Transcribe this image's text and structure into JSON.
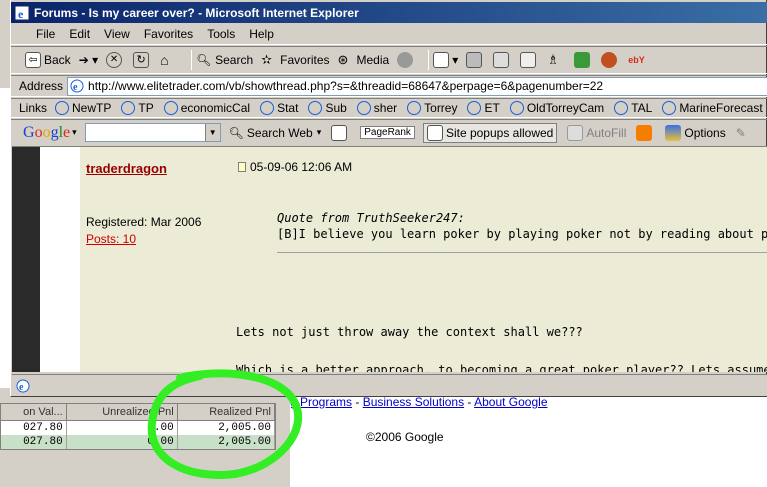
{
  "window": {
    "title": "Forums - Is my career over? - Microsoft Internet Explorer"
  },
  "menu": [
    "File",
    "Edit",
    "View",
    "Favorites",
    "Tools",
    "Help"
  ],
  "toolbar": {
    "back_label": "Back",
    "search_label": "Search",
    "favorites_label": "Favorites",
    "media_label": "Media"
  },
  "address": {
    "label": "Address",
    "url": "http://www.elitetrader.com/vb/showthread.php?s=&threadid=68647&perpage=6&pagenumber=22"
  },
  "links": {
    "label": "Links",
    "items": [
      "NewTP",
      "TP",
      "economicCal",
      "Stat",
      "Sub",
      "sher",
      "Torrey",
      "ET",
      "OldTorreyCam",
      "TAL",
      "MarineForecast"
    ]
  },
  "googlebar": {
    "logo": "Google",
    "search_web": "Search Web",
    "pagerank": "PageRank",
    "popups": "Site popups allowed",
    "autofill": "AutoFill",
    "options": "Options"
  },
  "post": {
    "username": "traderdragon",
    "date": "05-09-06 12:06 AM",
    "registered": "Registered: Mar 2006",
    "posts": "Posts: 10",
    "quote_from": "Quote from TruthSeeker247:",
    "quote_text": "[B]I believe you learn poker by playing poker not by reading about poker.",
    "body_line1": "Lets not just throw away the context shall we???",
    "body_line2": "Which is a better approach, to becoming a great poker player?? Lets assume you"
  },
  "google_page": {
    "link1": "g Programs",
    "link2": "Business Solutions",
    "link3": "About Google",
    "dash": " - ",
    "copyright": "©2006 Google"
  },
  "trade_table": {
    "headers": [
      "on Val...",
      "Unrealized Pnl",
      "Realized Pnl"
    ],
    "rows": [
      [
        "027.80",
        "0.00",
        "2,005.00"
      ],
      [
        "027.80",
        "0.00",
        "2,005.00"
      ]
    ]
  },
  "colors": {
    "annotation": "#33ee22",
    "title_bar": "#0a246a",
    "content_bg": "#ebebd6",
    "username": "#990000"
  }
}
